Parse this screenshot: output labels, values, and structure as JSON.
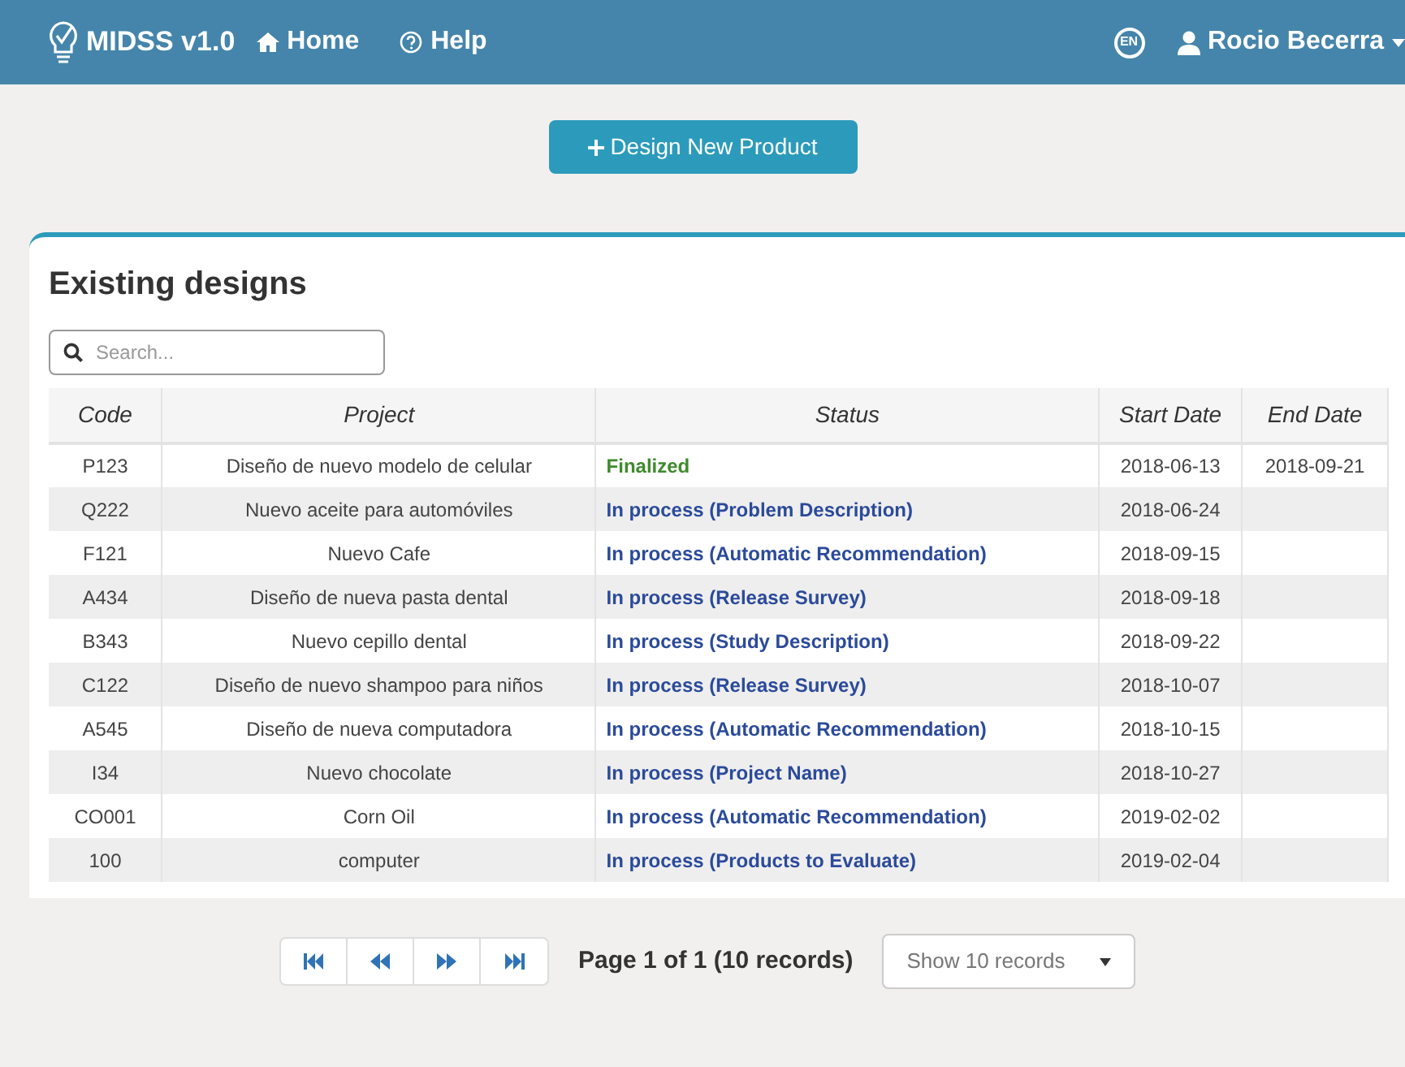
{
  "navbar": {
    "brand": "MIDSS v1.0",
    "links": [
      {
        "label": "Home"
      },
      {
        "label": "Help"
      }
    ],
    "language": "EN",
    "user": "Rocio Becerra"
  },
  "new_button": "Design New Product",
  "panel": {
    "title": "Existing designs",
    "search": {
      "placeholder": "Search..."
    }
  },
  "table": {
    "columns": [
      "Code",
      "Project",
      "Status",
      "Start Date",
      "End Date"
    ],
    "rows": [
      {
        "code": "P123",
        "project": "Diseño de nuevo modelo de celular",
        "status": "Finalized",
        "kind": "finalized",
        "start": "2018-06-13",
        "end": "2018-09-21"
      },
      {
        "code": "Q222",
        "project": "Nuevo aceite para automóviles",
        "status": "In process (Problem Description)",
        "kind": "in_process",
        "start": "2018-06-24"
      },
      {
        "code": "F121",
        "project": "Nuevo Cafe",
        "status": "In process (Automatic Recommendation)",
        "kind": "in_process",
        "start": "2018-09-15"
      },
      {
        "code": "A434",
        "project": "Diseño de nueva pasta dental",
        "status": "In process (Release Survey)",
        "kind": "in_process",
        "start": "2018-09-18"
      },
      {
        "code": "B343",
        "project": "Nuevo cepillo dental",
        "status": "In process (Study Description)",
        "kind": "in_process",
        "start": "2018-09-22"
      },
      {
        "code": "C122",
        "project": "Diseño de nuevo shampoo para niños",
        "status": "In process (Release Survey)",
        "kind": "in_process",
        "start": "2018-10-07"
      },
      {
        "code": "A545",
        "project": "Diseño de nueva computadora",
        "status": "In process (Automatic Recommendation)",
        "kind": "in_process",
        "start": "2018-10-15"
      },
      {
        "code": "I34",
        "project": "Nuevo chocolate",
        "status": "In process (Project Name)",
        "kind": "in_process",
        "start": "2018-10-27"
      },
      {
        "code": "CO001",
        "project": "Corn Oil",
        "status": "In process (Automatic Recommendation)",
        "kind": "in_process",
        "start": "2019-02-02"
      },
      {
        "code": "100",
        "project": "computer",
        "status": "In process (Products to Evaluate)",
        "kind": "in_process",
        "start": "2019-02-04"
      }
    ]
  },
  "pagination": {
    "info": "Page 1 of 1 (10 records)",
    "page_size": "Show 10 records"
  }
}
